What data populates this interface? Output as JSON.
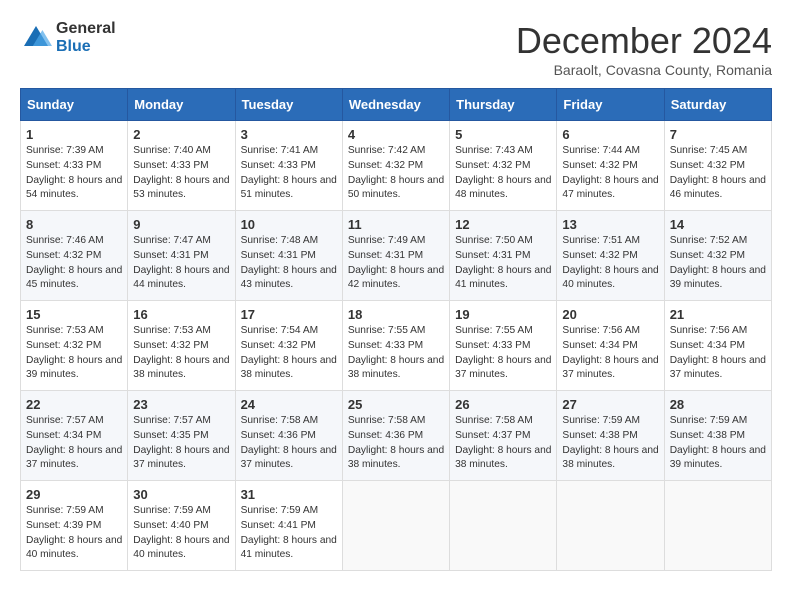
{
  "logo": {
    "general": "General",
    "blue": "Blue"
  },
  "title": "December 2024",
  "subtitle": "Baraolt, Covasna County, Romania",
  "weekdays": [
    "Sunday",
    "Monday",
    "Tuesday",
    "Wednesday",
    "Thursday",
    "Friday",
    "Saturday"
  ],
  "weeks": [
    [
      {
        "day": "1",
        "sunrise": "Sunrise: 7:39 AM",
        "sunset": "Sunset: 4:33 PM",
        "daylight": "Daylight: 8 hours and 54 minutes."
      },
      {
        "day": "2",
        "sunrise": "Sunrise: 7:40 AM",
        "sunset": "Sunset: 4:33 PM",
        "daylight": "Daylight: 8 hours and 53 minutes."
      },
      {
        "day": "3",
        "sunrise": "Sunrise: 7:41 AM",
        "sunset": "Sunset: 4:33 PM",
        "daylight": "Daylight: 8 hours and 51 minutes."
      },
      {
        "day": "4",
        "sunrise": "Sunrise: 7:42 AM",
        "sunset": "Sunset: 4:32 PM",
        "daylight": "Daylight: 8 hours and 50 minutes."
      },
      {
        "day": "5",
        "sunrise": "Sunrise: 7:43 AM",
        "sunset": "Sunset: 4:32 PM",
        "daylight": "Daylight: 8 hours and 48 minutes."
      },
      {
        "day": "6",
        "sunrise": "Sunrise: 7:44 AM",
        "sunset": "Sunset: 4:32 PM",
        "daylight": "Daylight: 8 hours and 47 minutes."
      },
      {
        "day": "7",
        "sunrise": "Sunrise: 7:45 AM",
        "sunset": "Sunset: 4:32 PM",
        "daylight": "Daylight: 8 hours and 46 minutes."
      }
    ],
    [
      {
        "day": "8",
        "sunrise": "Sunrise: 7:46 AM",
        "sunset": "Sunset: 4:32 PM",
        "daylight": "Daylight: 8 hours and 45 minutes."
      },
      {
        "day": "9",
        "sunrise": "Sunrise: 7:47 AM",
        "sunset": "Sunset: 4:31 PM",
        "daylight": "Daylight: 8 hours and 44 minutes."
      },
      {
        "day": "10",
        "sunrise": "Sunrise: 7:48 AM",
        "sunset": "Sunset: 4:31 PM",
        "daylight": "Daylight: 8 hours and 43 minutes."
      },
      {
        "day": "11",
        "sunrise": "Sunrise: 7:49 AM",
        "sunset": "Sunset: 4:31 PM",
        "daylight": "Daylight: 8 hours and 42 minutes."
      },
      {
        "day": "12",
        "sunrise": "Sunrise: 7:50 AM",
        "sunset": "Sunset: 4:31 PM",
        "daylight": "Daylight: 8 hours and 41 minutes."
      },
      {
        "day": "13",
        "sunrise": "Sunrise: 7:51 AM",
        "sunset": "Sunset: 4:32 PM",
        "daylight": "Daylight: 8 hours and 40 minutes."
      },
      {
        "day": "14",
        "sunrise": "Sunrise: 7:52 AM",
        "sunset": "Sunset: 4:32 PM",
        "daylight": "Daylight: 8 hours and 39 minutes."
      }
    ],
    [
      {
        "day": "15",
        "sunrise": "Sunrise: 7:53 AM",
        "sunset": "Sunset: 4:32 PM",
        "daylight": "Daylight: 8 hours and 39 minutes."
      },
      {
        "day": "16",
        "sunrise": "Sunrise: 7:53 AM",
        "sunset": "Sunset: 4:32 PM",
        "daylight": "Daylight: 8 hours and 38 minutes."
      },
      {
        "day": "17",
        "sunrise": "Sunrise: 7:54 AM",
        "sunset": "Sunset: 4:32 PM",
        "daylight": "Daylight: 8 hours and 38 minutes."
      },
      {
        "day": "18",
        "sunrise": "Sunrise: 7:55 AM",
        "sunset": "Sunset: 4:33 PM",
        "daylight": "Daylight: 8 hours and 38 minutes."
      },
      {
        "day": "19",
        "sunrise": "Sunrise: 7:55 AM",
        "sunset": "Sunset: 4:33 PM",
        "daylight": "Daylight: 8 hours and 37 minutes."
      },
      {
        "day": "20",
        "sunrise": "Sunrise: 7:56 AM",
        "sunset": "Sunset: 4:34 PM",
        "daylight": "Daylight: 8 hours and 37 minutes."
      },
      {
        "day": "21",
        "sunrise": "Sunrise: 7:56 AM",
        "sunset": "Sunset: 4:34 PM",
        "daylight": "Daylight: 8 hours and 37 minutes."
      }
    ],
    [
      {
        "day": "22",
        "sunrise": "Sunrise: 7:57 AM",
        "sunset": "Sunset: 4:34 PM",
        "daylight": "Daylight: 8 hours and 37 minutes."
      },
      {
        "day": "23",
        "sunrise": "Sunrise: 7:57 AM",
        "sunset": "Sunset: 4:35 PM",
        "daylight": "Daylight: 8 hours and 37 minutes."
      },
      {
        "day": "24",
        "sunrise": "Sunrise: 7:58 AM",
        "sunset": "Sunset: 4:36 PM",
        "daylight": "Daylight: 8 hours and 37 minutes."
      },
      {
        "day": "25",
        "sunrise": "Sunrise: 7:58 AM",
        "sunset": "Sunset: 4:36 PM",
        "daylight": "Daylight: 8 hours and 38 minutes."
      },
      {
        "day": "26",
        "sunrise": "Sunrise: 7:58 AM",
        "sunset": "Sunset: 4:37 PM",
        "daylight": "Daylight: 8 hours and 38 minutes."
      },
      {
        "day": "27",
        "sunrise": "Sunrise: 7:59 AM",
        "sunset": "Sunset: 4:38 PM",
        "daylight": "Daylight: 8 hours and 38 minutes."
      },
      {
        "day": "28",
        "sunrise": "Sunrise: 7:59 AM",
        "sunset": "Sunset: 4:38 PM",
        "daylight": "Daylight: 8 hours and 39 minutes."
      }
    ],
    [
      {
        "day": "29",
        "sunrise": "Sunrise: 7:59 AM",
        "sunset": "Sunset: 4:39 PM",
        "daylight": "Daylight: 8 hours and 40 minutes."
      },
      {
        "day": "30",
        "sunrise": "Sunrise: 7:59 AM",
        "sunset": "Sunset: 4:40 PM",
        "daylight": "Daylight: 8 hours and 40 minutes."
      },
      {
        "day": "31",
        "sunrise": "Sunrise: 7:59 AM",
        "sunset": "Sunset: 4:41 PM",
        "daylight": "Daylight: 8 hours and 41 minutes."
      },
      null,
      null,
      null,
      null
    ]
  ]
}
